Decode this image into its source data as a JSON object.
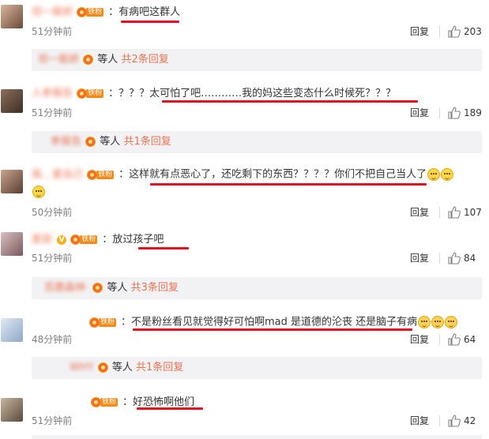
{
  "comments": [
    {
      "username": "坦一般娇",
      "badge_label": "铁粉",
      "text": "有病吧这群人",
      "time": "51分钟前",
      "reply_label": "回复",
      "likes": "203"
    },
    {
      "username": "人参报告",
      "badge_label": "铁粉",
      "text": "？？？太可怕了吧…………我的妈这些变态什么时候死？？？",
      "time": "51分钟前",
      "reply_label": "回复",
      "likes": "189"
    },
    {
      "username": "我…爱自己",
      "badge_label": "铁粉",
      "text": "这样就有点恶心了，还吃剩下的东西？？？？你们不把自己当人了",
      "time": "50分钟前",
      "reply_label": "回复",
      "likes": "107"
    },
    {
      "username": "星辰",
      "badge_label": "铁粉",
      "text": "放过孩子吧",
      "time": "51分钟前",
      "reply_label": "回复",
      "likes": "84"
    },
    {
      "username": "",
      "badge_label": "铁粉",
      "text": "不是粉丝看见就觉得好可怕啊mad 是道德的沦丧 还是脑子有病",
      "time": "48分钟前",
      "reply_label": "回复",
      "likes": "64"
    },
    {
      "username": "",
      "badge_label": "铁粉",
      "text": "好恐怖啊他们",
      "time": "51分钟前",
      "reply_label": "回复",
      "likes": "42"
    }
  ],
  "reply_bars": [
    {
      "name": "坦一般娇",
      "suffix": "等人",
      "link": "共2条回复"
    },
    {
      "name": "参报告",
      "suffix": "等人",
      "link": "共1条回复"
    },
    {
      "name": "百鹿森林·",
      "suffix": "等人",
      "link": "共3条回复"
    },
    {
      "name": "WHY",
      "suffix": "等人",
      "link": "共1条回复"
    }
  ],
  "colors": {
    "username": "#eb7350",
    "badge": "#f48b18",
    "underline": "#e8101f",
    "reply_bar_bg": "#f2f2f5"
  }
}
